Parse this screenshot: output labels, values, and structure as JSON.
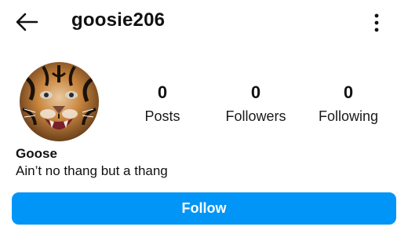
{
  "header": {
    "username": "goosie206",
    "back_icon": "arrow-left-icon",
    "more_icon": "more-vertical-icon"
  },
  "profile": {
    "avatar": "tiger-photo-avatar",
    "display_name": "Goose",
    "bio": "Ain’t no thang but a thang"
  },
  "stats": {
    "posts": {
      "count": "0",
      "label": "Posts"
    },
    "followers": {
      "count": "0",
      "label": "Followers"
    },
    "following": {
      "count": "0",
      "label": "Following"
    }
  },
  "actions": {
    "follow_label": "Follow",
    "follow_color": "#0095f6"
  }
}
